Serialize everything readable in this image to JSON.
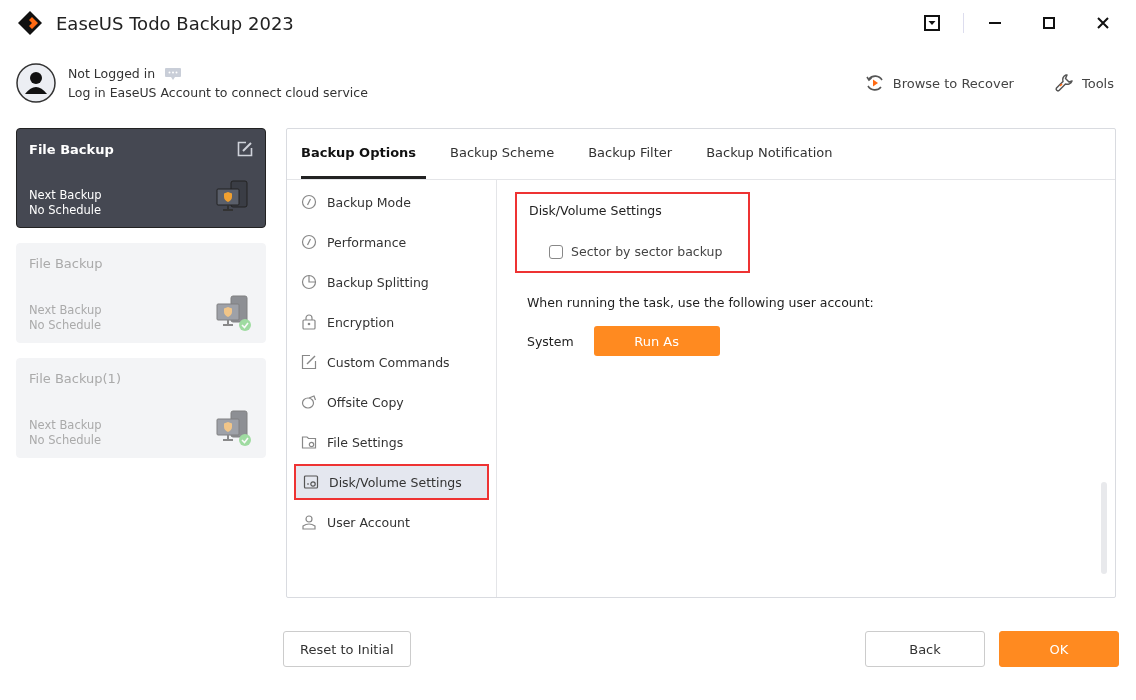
{
  "window": {
    "title": "EaseUS Todo Backup 2023"
  },
  "account": {
    "name": "Not Logged in",
    "hint": "Log in EaseUS Account to connect cloud service"
  },
  "toolbar": [
    {
      "label": "Browse to Recover",
      "kind": "recover"
    },
    {
      "label": "Tools",
      "kind": "tools"
    }
  ],
  "tasks": [
    {
      "title": "File Backup",
      "next_label": "Next Backup",
      "schedule": "No Schedule",
      "selected": true,
      "verified": false
    },
    {
      "title": "File Backup",
      "next_label": "Next Backup",
      "schedule": "No Schedule",
      "selected": false,
      "verified": true
    },
    {
      "title": "File Backup(1)",
      "next_label": "Next Backup",
      "schedule": "No Schedule",
      "selected": false,
      "verified": true
    }
  ],
  "tabs": [
    {
      "label": "Backup Options",
      "selected": true
    },
    {
      "label": "Backup Scheme",
      "selected": false
    },
    {
      "label": "Backup Filter",
      "selected": false
    },
    {
      "label": "Backup Notification",
      "selected": false
    }
  ],
  "menu": [
    {
      "label": "Backup Mode",
      "kind": "gauge",
      "selected": false,
      "highlighted": false
    },
    {
      "label": "Performance",
      "kind": "gauge",
      "selected": false,
      "highlighted": false
    },
    {
      "label": "Backup Splitting",
      "kind": "pie",
      "selected": false,
      "highlighted": false
    },
    {
      "label": "Encryption",
      "kind": "lock",
      "selected": false,
      "highlighted": false
    },
    {
      "label": "Custom Commands",
      "kind": "edit",
      "selected": false,
      "highlighted": false
    },
    {
      "label": "Offsite Copy",
      "kind": "copy",
      "selected": false,
      "highlighted": false
    },
    {
      "label": "File Settings",
      "kind": "folder",
      "selected": false,
      "highlighted": false
    },
    {
      "label": "Disk/Volume Settings",
      "kind": "disk",
      "selected": true,
      "highlighted": true
    },
    {
      "label": "User Account",
      "kind": "user",
      "selected": false,
      "highlighted": false
    }
  ],
  "settings": {
    "heading": "Disk/Volume Settings",
    "highlighted": true,
    "option": {
      "label": "Sector by sector backup",
      "checked": false
    },
    "account_note": "When running the task, use the following user account:",
    "account": "System",
    "run_as": "Run As"
  },
  "footer": {
    "reset": "Reset to Initial",
    "back": "Back",
    "ok": "OK"
  }
}
